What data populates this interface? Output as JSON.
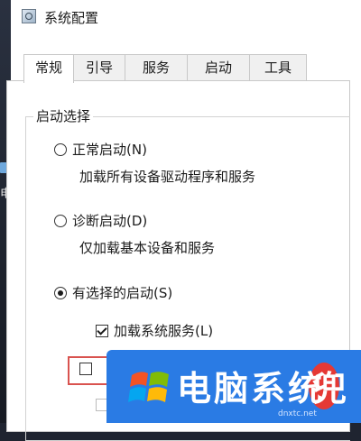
{
  "window": {
    "title": "系统配置"
  },
  "tabs": [
    {
      "label": "常规",
      "active": true
    },
    {
      "label": "引导",
      "active": false
    },
    {
      "label": "服务",
      "active": false
    },
    {
      "label": "启动",
      "active": false
    },
    {
      "label": "工具",
      "active": false
    }
  ],
  "startup": {
    "group_label": "启动选择",
    "options": [
      {
        "label": "正常启动(N)",
        "desc": "加载所有设备驱动程序和服务",
        "selected": false
      },
      {
        "label": "诊断启动(D)",
        "desc": "仅加载基本设备和服务",
        "selected": false
      },
      {
        "label": "有选择的启动(S)",
        "desc": "",
        "selected": true
      }
    ],
    "checks": [
      {
        "label": "加载系统服务(L)",
        "checked": true
      }
    ]
  },
  "desktop": {
    "side_char": "电"
  },
  "watermark": {
    "text": "电脑系统",
    "accent_char": "兜",
    "url": "dnxtc.net"
  },
  "colors": {
    "highlight": "#d9534f",
    "watermark_bg": "#2a7be4"
  }
}
